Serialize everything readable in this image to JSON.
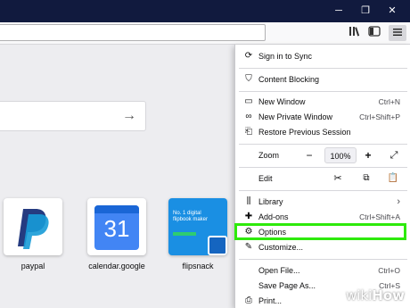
{
  "colors": {
    "titlebar": "#111a3e",
    "highlight": "#2eea0b",
    "accent": "#0a84ff"
  },
  "window_controls": {
    "minimize": "─",
    "restore": "❐",
    "close": "✕"
  },
  "toolbar": {
    "library_icon": "library-icon",
    "sidebar_icon": "sidebar-icon",
    "menu_icon": "hamburger-menu-icon"
  },
  "tiles": [
    {
      "label": "paypal",
      "icon": "paypal-logo"
    },
    {
      "label": "calendar.google",
      "icon": "calendar-icon",
      "day": "31"
    },
    {
      "label": "flipsnack",
      "icon": "flipsnack-thumbnail",
      "heading": "No. 1 digital flipbook maker"
    }
  ],
  "menu": {
    "sync": "Sign in to Sync",
    "content_blocking": "Content Blocking",
    "new_window": {
      "label": "New Window",
      "shortcut": "Ctrl+N"
    },
    "new_private": {
      "label": "New Private Window",
      "shortcut": "Ctrl+Shift+P"
    },
    "restore": "Restore Previous Session",
    "zoom": {
      "label": "Zoom",
      "minus": "−",
      "value": "100%",
      "plus": "+"
    },
    "edit": {
      "label": "Edit"
    },
    "library": "Library",
    "addons": {
      "label": "Add-ons",
      "shortcut": "Ctrl+Shift+A"
    },
    "options": "Options",
    "customize": "Customize...",
    "open_file": {
      "label": "Open File...",
      "shortcut": "Ctrl+O"
    },
    "save_page": {
      "label": "Save Page As...",
      "shortcut": "Ctrl+S"
    },
    "print": "Print..."
  },
  "watermark": {
    "wiki": "wiki",
    "how": "How"
  }
}
